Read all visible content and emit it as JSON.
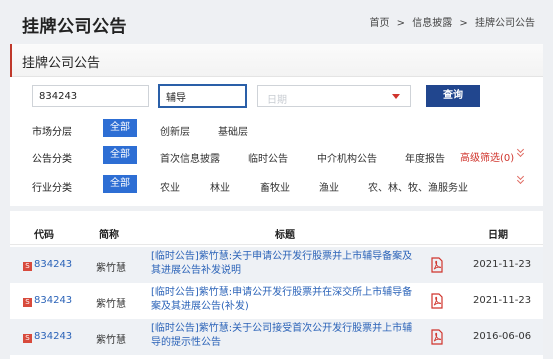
{
  "header": {
    "title": "挂牌公司公告",
    "breadcrumb": [
      "首页",
      "信息披露",
      "挂牌公司公告"
    ],
    "separator": ">"
  },
  "filter": {
    "section_title": "挂牌公司公告",
    "code_value": "834243",
    "name_value": "辅导",
    "date_placeholder": "日期",
    "query_label": "查询",
    "rows": [
      {
        "label": "市场分层",
        "all": "全部",
        "options": [
          "创新层",
          "基础层"
        ]
      },
      {
        "label": "公告分类",
        "all": "全部",
        "options": [
          "首次信息披露",
          "临时公告",
          "中介机构公告",
          "年度报告"
        ],
        "advanced": "高级筛选(0)"
      },
      {
        "label": "行业分类",
        "all": "全部",
        "options": [
          "农业",
          "林业",
          "畜牧业",
          "渔业",
          "农、林、牧、渔服务业"
        ]
      }
    ]
  },
  "table": {
    "headers": [
      "代码",
      "简称",
      "标题",
      "日期"
    ],
    "rows": [
      {
        "code": "834243",
        "name": "紫竹慧",
        "title": "[临时公告]紫竹慧:关于申请公开发行股票并上市辅导备案及其进展公告补发说明",
        "date": "2021-11-23"
      },
      {
        "code": "834243",
        "name": "紫竹慧",
        "title": "[临时公告]紫竹慧:申请公开发行股票并在深交所上市辅导备案及其进展公告(补发)",
        "date": "2021-11-23"
      },
      {
        "code": "834243",
        "name": "紫竹慧",
        "title": "[临时公告]紫竹慧:关于公司接受首次公开发行股票并上市辅导的提示性公告",
        "date": "2016-06-06"
      }
    ]
  },
  "colors": {
    "accent_blue": "#2d6ed4",
    "nav_blue": "#21468e",
    "link_blue": "#2b63b8",
    "red": "#d0342c"
  },
  "icons": {
    "pdf": "pdf-icon",
    "code_badge": "stock-badge-icon",
    "dropdown": "caret-down-icon",
    "expand": "chevron-double-down-icon"
  }
}
